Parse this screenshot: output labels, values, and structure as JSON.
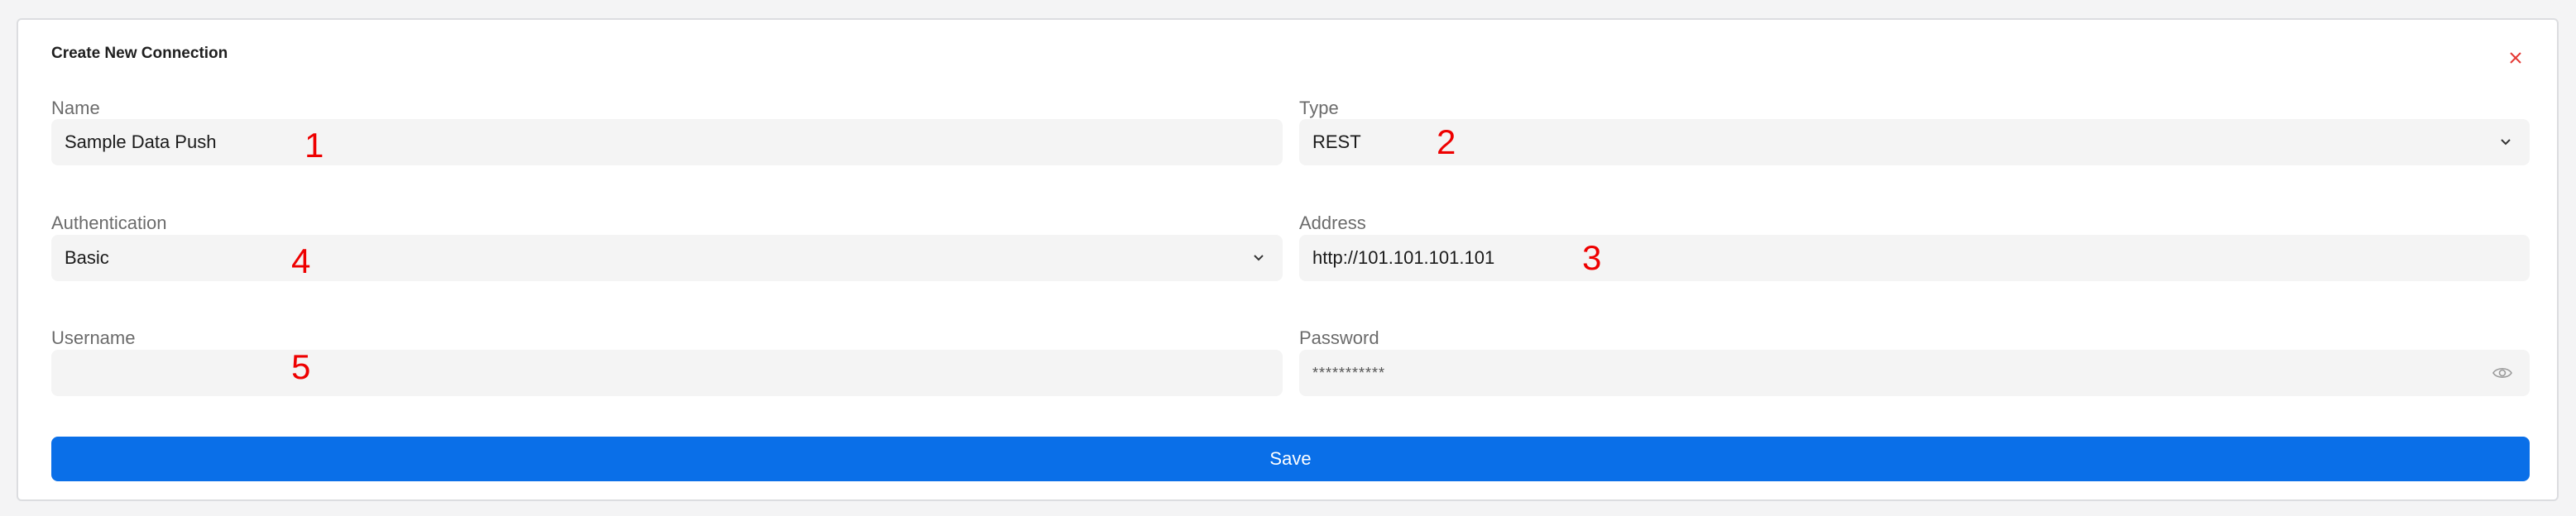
{
  "dialog": {
    "title": "Create New Connection",
    "close_icon": "close-icon",
    "accent_close_color": "#e53935"
  },
  "fields": {
    "name": {
      "label": "Name",
      "value": "Sample Data Push"
    },
    "type": {
      "label": "Type",
      "value": "REST"
    },
    "authentication": {
      "label": "Authentication",
      "value": "Basic"
    },
    "address": {
      "label": "Address",
      "value": "http://101.101.101.101"
    },
    "username": {
      "label": "Username",
      "value": ""
    },
    "password": {
      "label": "Password",
      "value": "***********"
    }
  },
  "annotations": [
    "1",
    "2",
    "3",
    "4",
    "5"
  ],
  "save_button": {
    "label": "Save",
    "color": "#0a6fe8"
  }
}
